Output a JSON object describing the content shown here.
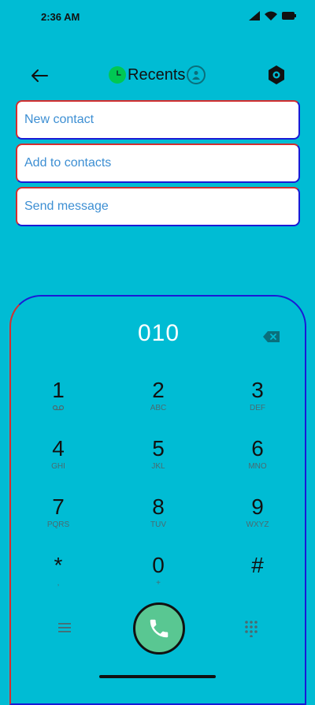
{
  "status_bar": {
    "time": "2:36 AM"
  },
  "header": {
    "title": "Recents",
    "back_icon": "arrow-left-icon",
    "settings_icon": "settings-icon"
  },
  "actions": [
    {
      "label": "New contact"
    },
    {
      "label": "Add to contacts"
    },
    {
      "label": "Send message"
    }
  ],
  "dialpad": {
    "number": "010",
    "keys": [
      {
        "digit": "1",
        "letters": "ᴼᴼ"
      },
      {
        "digit": "2",
        "letters": "ABC"
      },
      {
        "digit": "3",
        "letters": "DEF"
      },
      {
        "digit": "4",
        "letters": "GHI"
      },
      {
        "digit": "5",
        "letters": "JKL"
      },
      {
        "digit": "6",
        "letters": "MNO"
      },
      {
        "digit": "7",
        "letters": "PQRS"
      },
      {
        "digit": "8",
        "letters": "TUV"
      },
      {
        "digit": "9",
        "letters": "WXYZ"
      },
      {
        "digit": "*",
        "letters": ","
      },
      {
        "digit": "0",
        "letters": "+"
      },
      {
        "digit": "#",
        "letters": ""
      }
    ]
  },
  "colors": {
    "background": "#00BCD4",
    "call_button": "#59C792",
    "action_text": "#3D8FD3",
    "title_badge": "#00C853"
  }
}
